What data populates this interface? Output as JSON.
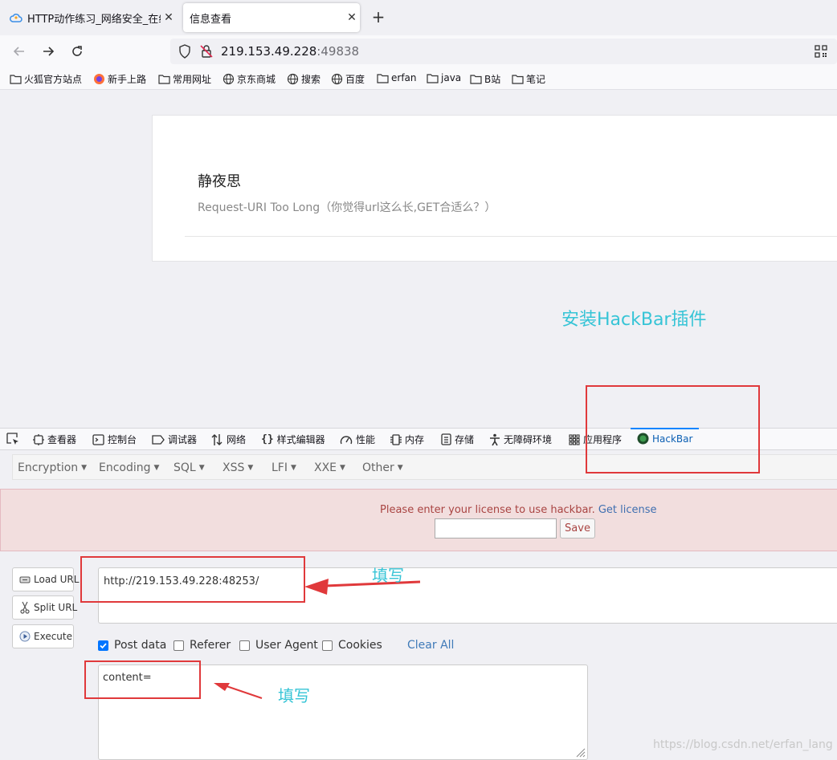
{
  "browser": {
    "tabs": [
      {
        "title": "HTTP动作练习_网络安全_在线",
        "icon": "cloud-icon"
      },
      {
        "title": "信息查看",
        "icon": "none",
        "active": true
      }
    ],
    "address": {
      "host": "219.153.49.228",
      "port": ":49838"
    },
    "bookmarks": [
      {
        "label": "火狐官方站点",
        "icon": "folder-icon"
      },
      {
        "label": "新手上路",
        "icon": "firefox-icon"
      },
      {
        "label": "常用网址",
        "icon": "folder-icon"
      },
      {
        "label": "京东商城",
        "icon": "globe-icon"
      },
      {
        "label": "搜索",
        "icon": "globe-icon"
      },
      {
        "label": "百度",
        "icon": "globe-icon"
      },
      {
        "label": "erfan",
        "icon": "folder-icon"
      },
      {
        "label": "java",
        "icon": "folder-icon"
      },
      {
        "label": "B站",
        "icon": "folder-icon"
      },
      {
        "label": "笔记",
        "icon": "folder-icon"
      }
    ]
  },
  "page": {
    "title": "静夜思",
    "subtitle": "Request-URI Too Long（你觉得url这么长,GET合适么？）"
  },
  "devtools": {
    "tabs": [
      {
        "label": "查看器",
        "icon": "inspector-icon"
      },
      {
        "label": "控制台",
        "icon": "console-icon"
      },
      {
        "label": "调试器",
        "icon": "debugger-icon"
      },
      {
        "label": "网络",
        "icon": "network-icon"
      },
      {
        "label": "样式编辑器",
        "icon": "style-editor-icon"
      },
      {
        "label": "性能",
        "icon": "performance-icon"
      },
      {
        "label": "内存",
        "icon": "memory-icon"
      },
      {
        "label": "存储",
        "icon": "storage-icon"
      },
      {
        "label": "无障碍环境",
        "icon": "accessibility-icon"
      },
      {
        "label": "应用程序",
        "icon": "application-icon"
      },
      {
        "label": "HackBar",
        "icon": "hackbar-icon",
        "active": true
      }
    ]
  },
  "hackbar": {
    "menu": [
      "Encryption",
      "Encoding",
      "SQL",
      "XSS",
      "LFI",
      "XXE",
      "Other"
    ],
    "license": {
      "message": "Please enter your license to use hackbar.",
      "link": "Get license",
      "input_value": "",
      "save_label": "Save"
    },
    "actions": {
      "load": "Load URL",
      "split": "Split URL",
      "execute": "Execute"
    },
    "url_value": "http://219.153.49.228:48253/",
    "checkboxes": {
      "post_data": {
        "label": "Post data",
        "checked": true
      },
      "referer": {
        "label": "Referer",
        "checked": false
      },
      "user_agent": {
        "label": "User Agent",
        "checked": false
      },
      "cookies": {
        "label": "Cookies",
        "checked": false
      }
    },
    "clear_all": "Clear All",
    "post_value": "content="
  },
  "annotations": {
    "install": "安装HackBar插件",
    "fill_url": "填写",
    "fill_post": "填写",
    "color_box": "#e0393b",
    "color_text": "#36c4d6"
  },
  "watermark": "https://blog.csdn.net/erfan_lang"
}
